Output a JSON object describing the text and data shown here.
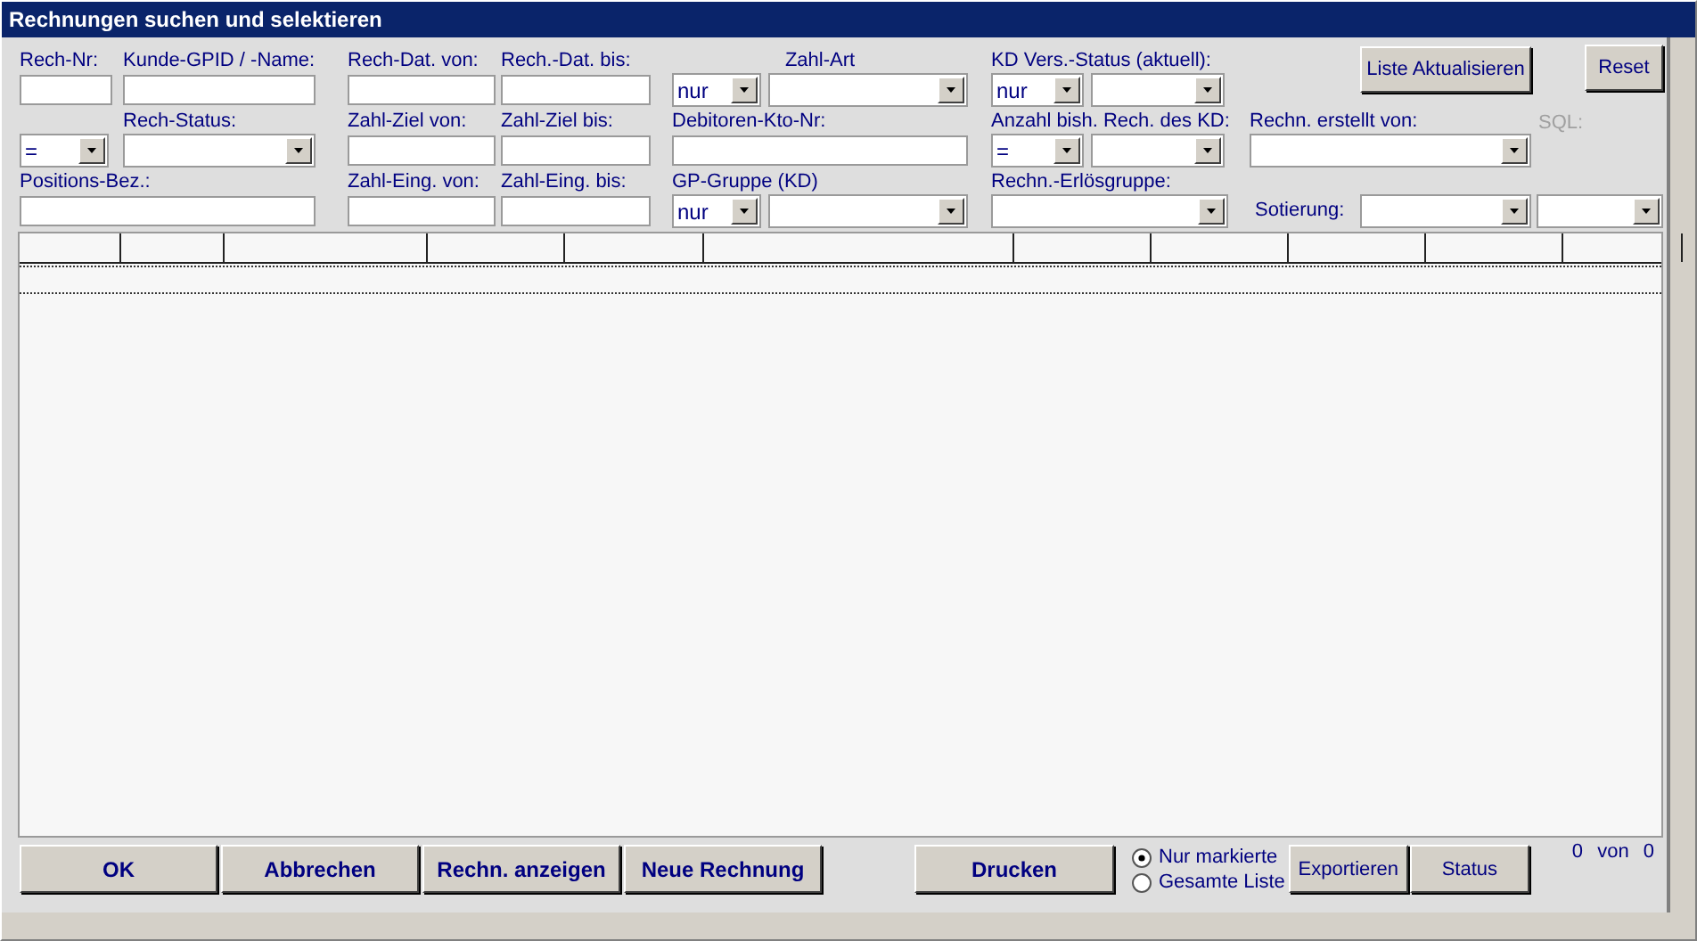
{
  "window": {
    "title": "Rechnungen suchen und selektieren"
  },
  "filters": {
    "rech_nr": {
      "label": "Rech-Nr:"
    },
    "kunde": {
      "label": "Kunde-GPID / -Name:"
    },
    "rech_dat_von": {
      "label": "Rech-Dat. von:"
    },
    "rech_dat_bis": {
      "label": "Rech.-Dat. bis:"
    },
    "zahl_art": {
      "label": "Zahl-Art",
      "operator": "nur"
    },
    "kd_vers_status": {
      "label": "KD Vers.-Status (aktuell):",
      "operator": "nur"
    },
    "rech_status": {
      "label": "Rech-Status:",
      "operator": "="
    },
    "zahl_ziel_von": {
      "label": "Zahl-Ziel von:"
    },
    "zahl_ziel_bis": {
      "label": "Zahl-Ziel bis:"
    },
    "debitoren": {
      "label": "Debitoren-Kto-Nr:"
    },
    "anzahl": {
      "label": "Anzahl bish. Rech. des KD:",
      "operator": "="
    },
    "erstellt_von": {
      "label": "Rechn. erstellt von:"
    },
    "positions": {
      "label": "Positions-Bez.:"
    },
    "zahl_eing_von": {
      "label": "Zahl-Eing. von:"
    },
    "zahl_eing_bis": {
      "label": "Zahl-Eing. bis:"
    },
    "gp_gruppe": {
      "label": "GP-Gruppe (KD)",
      "operator": "nur"
    },
    "erloesgruppe": {
      "label": "Rechn.-Erlösgruppe:"
    },
    "sortierung": {
      "label": "Sotierung:"
    }
  },
  "sql_label": "SQL:",
  "top_buttons": [
    {
      "label": "Liste Aktualisieren"
    },
    {
      "label": "Reset"
    }
  ],
  "bottom_buttons": [
    {
      "label": "OK"
    },
    {
      "label": "Abbrechen"
    },
    {
      "label": "Rechn. anzeigen"
    },
    {
      "label": "Neue Rechnung"
    }
  ],
  "print_button": {
    "label": "Drucken"
  },
  "export_scope": [
    {
      "label": "Nur markierte",
      "selected": true
    },
    {
      "label": "Gesamte Liste",
      "selected": false
    }
  ],
  "export_button": {
    "label": "Exportieren"
  },
  "status_button": {
    "label": "Status"
  },
  "record_count": "0 von 0"
}
